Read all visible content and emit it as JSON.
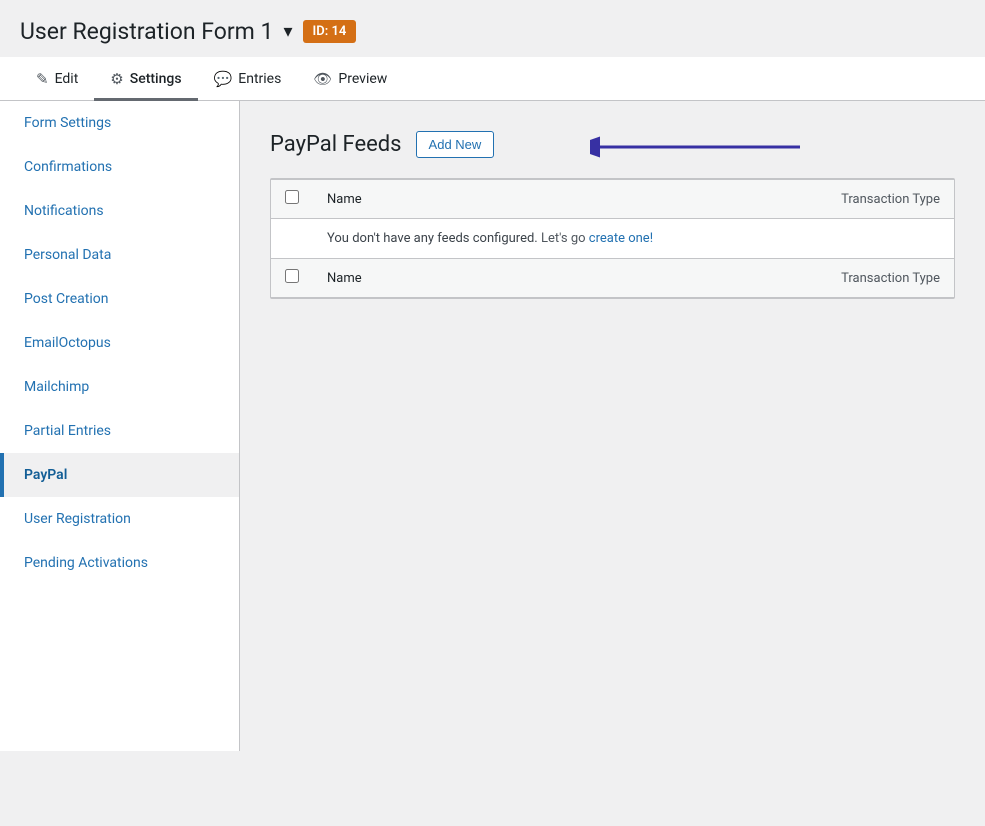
{
  "header": {
    "title": "User Registration Form 1",
    "dropdown_icon": "▾",
    "id_badge": "ID: 14"
  },
  "nav_tabs": [
    {
      "label": "Edit",
      "icon": "✎",
      "active": false,
      "name": "tab-edit"
    },
    {
      "label": "Settings",
      "icon": "⚙",
      "active": true,
      "name": "tab-settings"
    },
    {
      "label": "Entries",
      "icon": "💬",
      "active": false,
      "name": "tab-entries"
    },
    {
      "label": "Preview",
      "icon": "👁",
      "active": false,
      "name": "tab-preview"
    }
  ],
  "sidebar": {
    "items": [
      {
        "label": "Form Settings",
        "active": false,
        "name": "sidebar-form-settings"
      },
      {
        "label": "Confirmations",
        "active": false,
        "name": "sidebar-confirmations"
      },
      {
        "label": "Notifications",
        "active": false,
        "name": "sidebar-notifications"
      },
      {
        "label": "Personal Data",
        "active": false,
        "name": "sidebar-personal-data"
      },
      {
        "label": "Post Creation",
        "active": false,
        "name": "sidebar-post-creation"
      },
      {
        "label": "EmailOctopus",
        "active": false,
        "name": "sidebar-emailoctopus"
      },
      {
        "label": "Mailchimp",
        "active": false,
        "name": "sidebar-mailchimp"
      },
      {
        "label": "Partial Entries",
        "active": false,
        "name": "sidebar-partial-entries"
      },
      {
        "label": "PayPal",
        "active": true,
        "name": "sidebar-paypal"
      },
      {
        "label": "User Registration",
        "active": false,
        "name": "sidebar-user-registration"
      },
      {
        "label": "Pending Activations",
        "active": false,
        "name": "sidebar-pending-activations"
      }
    ]
  },
  "content": {
    "page_title": "PayPal Feeds",
    "add_new_label": "Add New",
    "table": {
      "col_name": "Name",
      "col_type": "Transaction Type",
      "empty_message_prefix": "You don't have any feeds configured.",
      "empty_message_lets_go": "Let's go",
      "empty_message_link": "create one!",
      "footer_col_name": "Name",
      "footer_col_type": "Transaction Type"
    }
  }
}
